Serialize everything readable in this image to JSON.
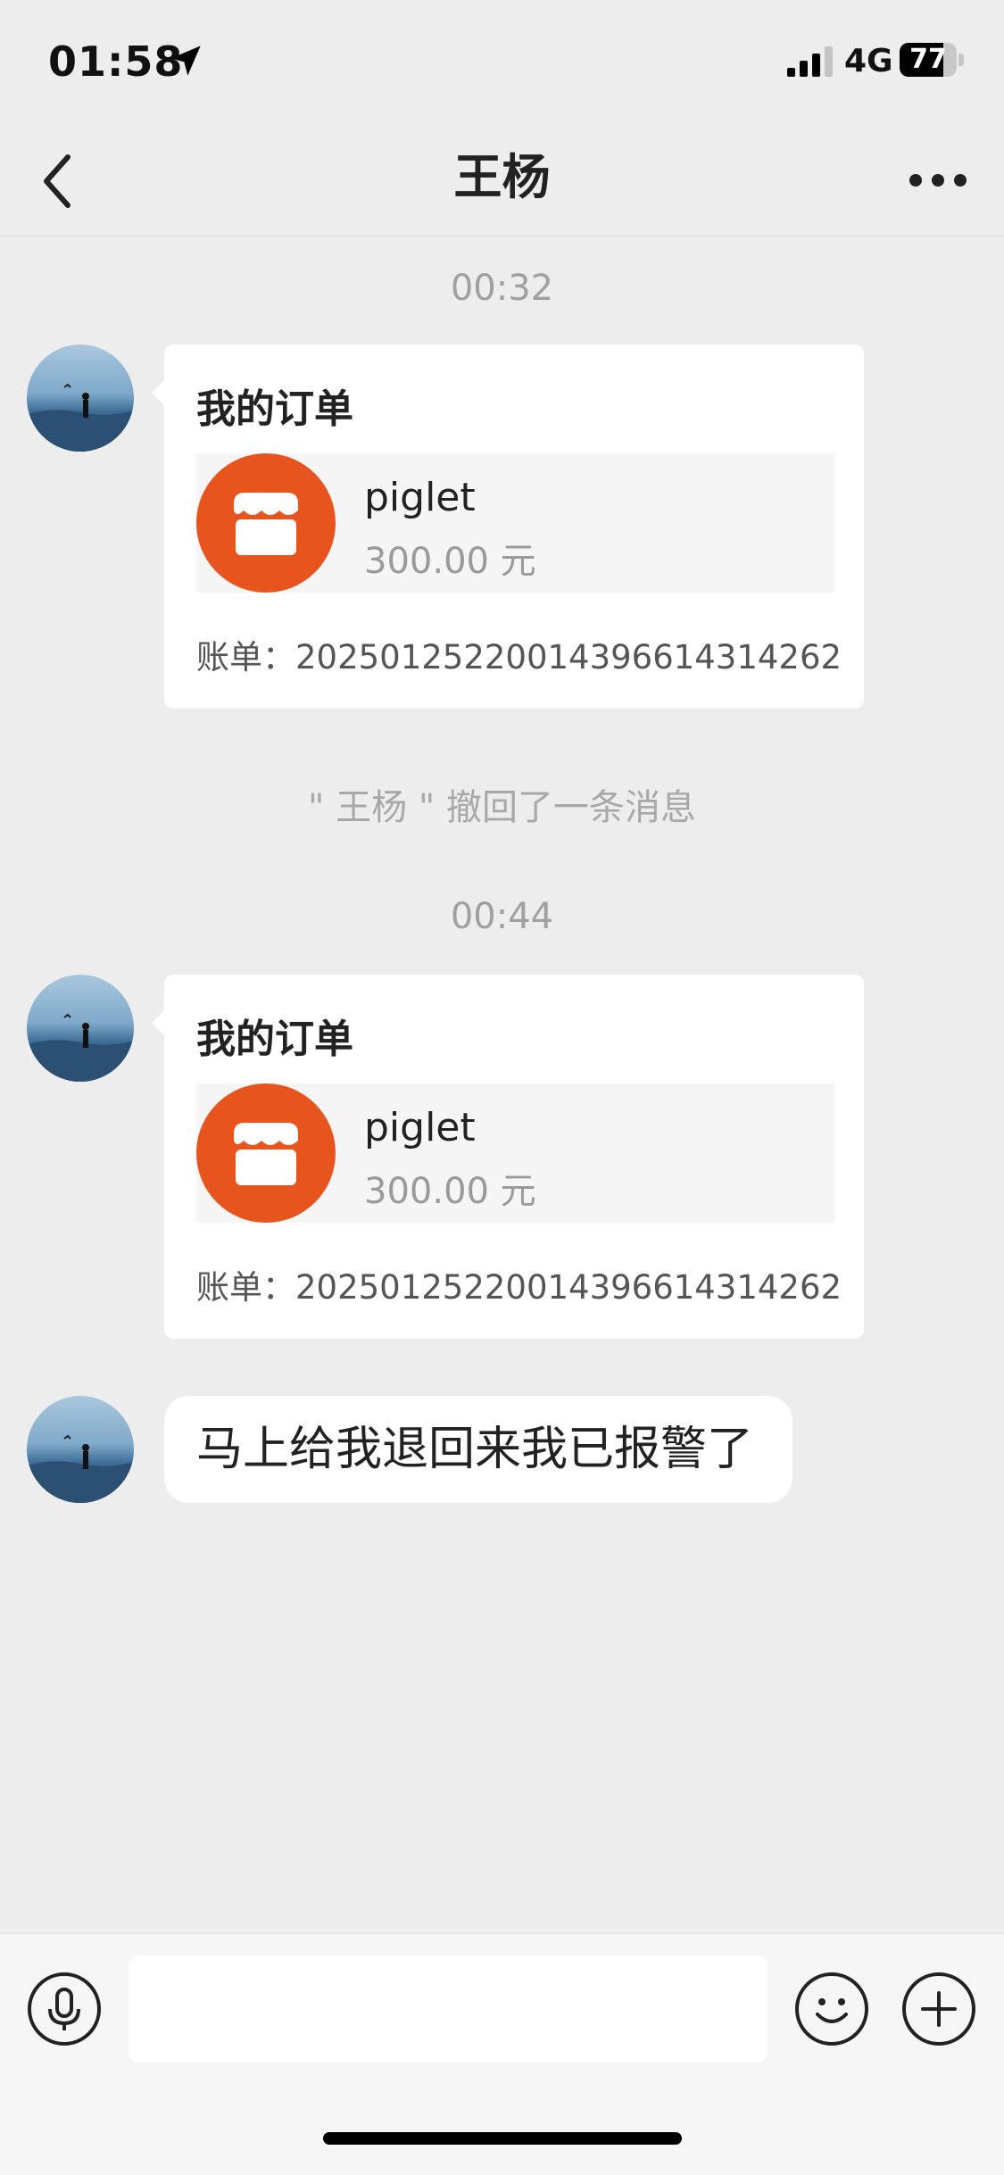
{
  "status_bar": {
    "time": "01:58",
    "network": "4G",
    "battery": "77",
    "battery_level": 0.77
  },
  "nav": {
    "title": "王杨"
  },
  "messages": [
    {
      "time": "00:32",
      "type": "order",
      "title": "我的订单",
      "merchant": "piglet",
      "amount": "300.00 元",
      "bill": "账单：20250125220014396614314262"
    },
    {
      "type": "notice",
      "text": "\" 王杨 \" 撤回了一条消息"
    },
    {
      "time": "00:44",
      "type": "order",
      "title": "我的订单",
      "merchant": "piglet",
      "amount": "300.00 元",
      "bill": "账单：20250125220014396614314262"
    },
    {
      "type": "text",
      "text": "马上给我退回来我已报警了"
    }
  ],
  "input": {
    "value": ""
  },
  "colors": {
    "background": "#ededed",
    "bubble": "#ffffff",
    "merchant_logo": "#e8541e",
    "muted_text": "#a0a0a0"
  },
  "icons": {
    "status": [
      "location-arrow-icon",
      "signal-icon",
      "battery-icon"
    ],
    "nav": [
      "back-chevron-icon",
      "more-dots-icon"
    ],
    "merchant": "storefront-icon",
    "input": [
      "voice-icon",
      "emoji-icon",
      "plus-icon"
    ]
  }
}
